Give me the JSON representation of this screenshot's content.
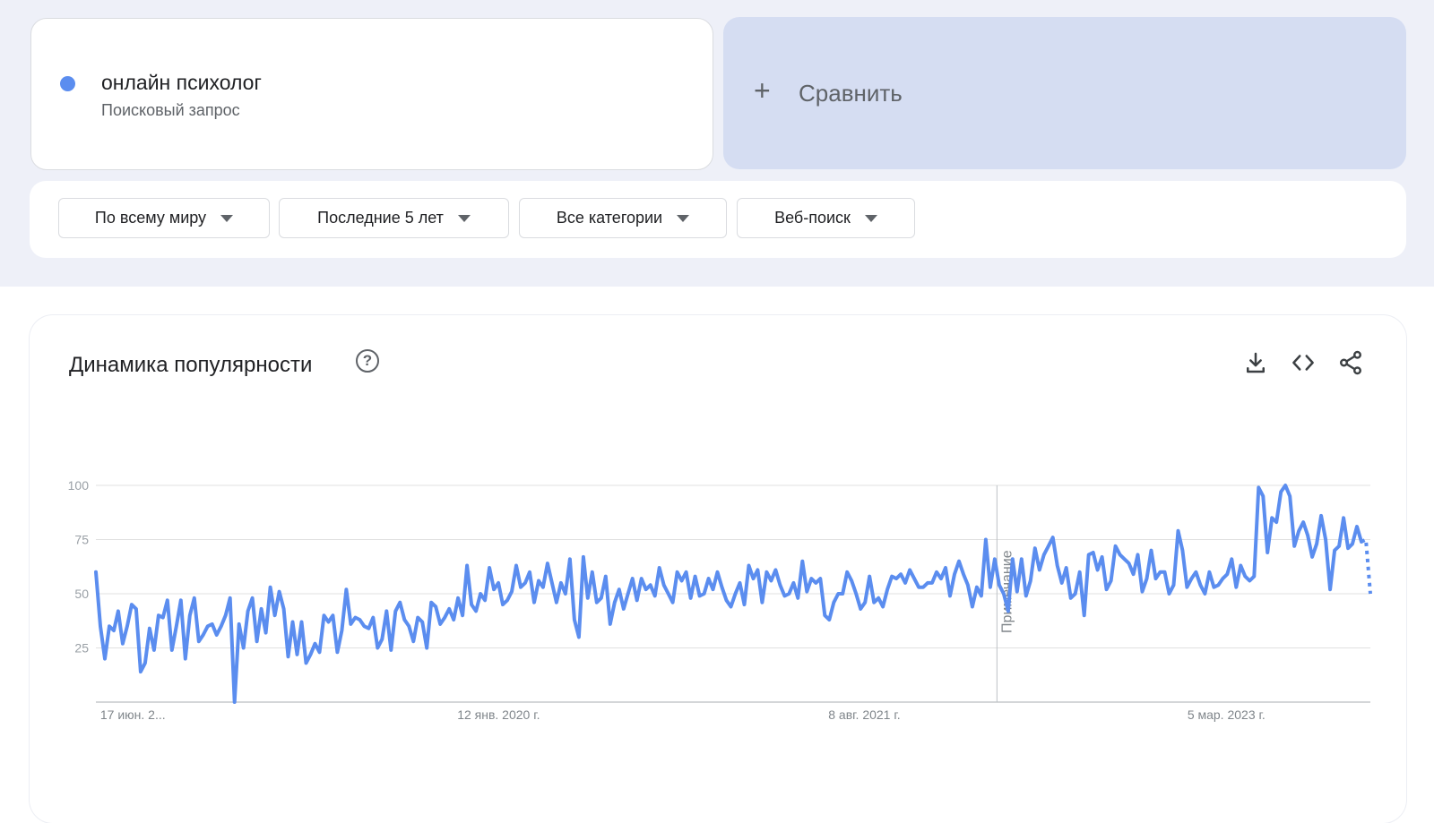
{
  "term": {
    "name": "онлайн психолог",
    "type": "Поисковый запрос",
    "color": "#5b8def"
  },
  "compare": {
    "plus": "+",
    "label": "Сравнить"
  },
  "filters": [
    {
      "label": "По всему миру"
    },
    {
      "label": "Последние 5 лет"
    },
    {
      "label": "Все категории"
    },
    {
      "label": "Веб-поиск"
    }
  ],
  "trend": {
    "title": "Динамика популярности",
    "help": "?",
    "icons": [
      "download-icon",
      "embed-code-icon",
      "share-icon"
    ]
  },
  "chart_data": {
    "type": "line",
    "series_color": "#5b8def",
    "grid_color": "#e0e0e0",
    "ylim": [
      0,
      100
    ],
    "y_ticks": [
      25,
      50,
      75,
      100
    ],
    "x_ticks": [
      "17 июн. 2...",
      "12 янв. 2020 г.",
      "8 авг. 2021 г.",
      "5 мар. 2023 г."
    ],
    "x_tick_positions": [
      0.029,
      0.316,
      0.603,
      0.887
    ],
    "annotation": {
      "label": "Примечание",
      "position": 0.707
    },
    "dashed_tail": 2,
    "values": [
      60,
      35,
      20,
      35,
      33,
      42,
      27,
      35,
      45,
      43,
      14,
      18,
      34,
      24,
      40,
      39,
      47,
      24,
      35,
      47,
      20,
      40,
      48,
      28,
      31,
      35,
      36,
      31,
      35,
      40,
      48,
      0,
      36,
      25,
      42,
      48,
      28,
      43,
      32,
      53,
      40,
      51,
      43,
      21,
      37,
      22,
      37,
      18,
      22,
      27,
      23,
      40,
      37,
      40,
      23,
      33,
      52,
      36,
      39,
      38,
      35,
      34,
      39,
      25,
      29,
      42,
      24,
      42,
      46,
      38,
      35,
      28,
      39,
      37,
      25,
      46,
      44,
      36,
      39,
      43,
      38,
      48,
      40,
      63,
      45,
      42,
      50,
      47,
      62,
      52,
      55,
      45,
      47,
      51,
      63,
      53,
      55,
      60,
      46,
      56,
      53,
      64,
      55,
      46,
      55,
      50,
      66,
      38,
      30,
      67,
      48,
      60,
      46,
      48,
      58,
      36,
      46,
      52,
      43,
      50,
      57,
      47,
      57,
      52,
      54,
      49,
      62,
      54,
      50,
      46,
      60,
      56,
      60,
      48,
      58,
      49,
      50,
      57,
      52,
      60,
      53,
      47,
      44,
      50,
      55,
      45,
      63,
      57,
      61,
      46,
      60,
      56,
      61,
      54,
      49,
      50,
      55,
      48,
      65,
      51,
      57,
      55,
      57,
      40,
      38,
      46,
      50,
      50,
      60,
      56,
      50,
      43,
      46,
      58,
      46,
      48,
      44,
      52,
      58,
      57,
      59,
      55,
      61,
      57,
      53,
      53,
      55,
      55,
      60,
      57,
      62,
      49,
      59,
      65,
      59,
      54,
      44,
      53,
      49,
      75,
      53,
      66,
      54,
      50,
      42,
      66,
      51,
      66,
      49,
      56,
      71,
      61,
      68,
      72,
      76,
      63,
      55,
      62,
      48,
      50,
      60,
      40,
      68,
      69,
      61,
      67,
      52,
      56,
      72,
      68,
      66,
      64,
      59,
      68,
      51,
      57,
      70,
      57,
      60,
      60,
      50,
      54,
      79,
      70,
      53,
      57,
      60,
      54,
      50,
      60,
      53,
      54,
      57,
      59,
      66,
      53,
      63,
      58,
      56,
      58,
      99,
      95,
      69,
      85,
      83,
      97,
      100,
      95,
      72,
      79,
      83,
      77,
      67,
      73,
      86,
      75,
      52,
      70,
      72,
      85,
      71,
      73,
      81,
      74,
      75,
      50
    ]
  }
}
